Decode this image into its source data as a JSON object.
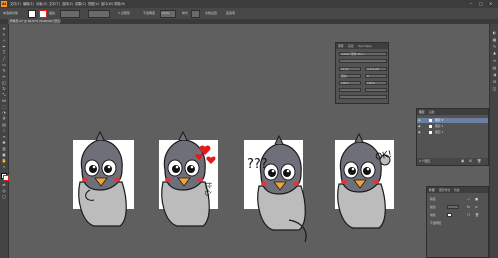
{
  "app": {
    "logo": "Ai"
  },
  "menu": [
    "文件(F)",
    "编辑(E)",
    "对象(O)",
    "文字(T)",
    "选择(S)",
    "效果(C)",
    "视图(V)",
    "窗口(W)",
    "帮助(H)"
  ],
  "window_controls": {
    "minimize": "─",
    "maximize": "□",
    "close": "✕"
  },
  "control_bar": {
    "selection_label": "未选择对象",
    "stroke_label": "描边",
    "brush_label": "5 点圆形",
    "opacity_label": "不透明度",
    "opacity_value": "100%",
    "style_label": "样式",
    "doc_setup": "文档设置",
    "prefs": "首选项"
  },
  "document_tab": {
    "title": "鸭嘴兽.ai* @ 66.67% (RGB/GPU 预览)",
    "close": "×"
  },
  "character_panel": {
    "tabs": [
      "字符",
      "段落",
      "OpenType"
    ],
    "font_label": "Adobe 宋体 Std L",
    "rows": [
      "12 pt",
      "(14.4 pt)",
      "自动",
      "0",
      "100%",
      "100%"
    ]
  },
  "layers_panel": {
    "tabs": [
      "图层",
      "画板"
    ],
    "layers": [
      "图层 3",
      "图层 2",
      "图层 1"
    ],
    "footer": "3 个图层"
  },
  "appearance_panel": {
    "tabs": [
      "外观",
      "图形样式",
      "色板"
    ],
    "items": [
      "路径",
      "描边",
      "填色",
      "不透明度"
    ]
  },
  "stickers": [
    {
      "caption": ""
    },
    {
      "caption": "比心"
    },
    {
      "caption": "???"
    },
    {
      "caption": "OK!"
    }
  ],
  "colors": {
    "canvas": "#5f5f5f",
    "heart": "#e31b1b",
    "blush": "#e8313a",
    "beak": "#f2a23a"
  }
}
